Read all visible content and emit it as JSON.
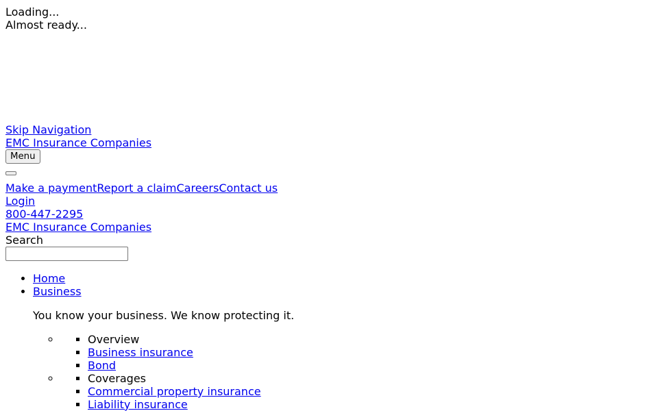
{
  "loading": {
    "line1": "Loading...",
    "line2": "Almost ready..."
  },
  "header": {
    "skip_nav": "Skip Navigation",
    "logo_alt": "EMC Insurance Companies",
    "menu_button": "Menu",
    "utility_links": [
      "Make a payment",
      "Report a claim",
      "Careers",
      "Contact us"
    ],
    "login": "Login",
    "phone": "800-447-2295",
    "logo_alt_2": "EMC Insurance Companies",
    "search_label": "Search",
    "search_value": ""
  },
  "nav": {
    "home": "Home",
    "business": "Business",
    "business_tagline": "You know your business. We know protecting it.",
    "groups": [
      {
        "heading": "Overview",
        "links": [
          "Business insurance",
          "Bond"
        ]
      },
      {
        "heading": "Coverages",
        "links": [
          "Commercial property insurance",
          "Liability insurance"
        ]
      }
    ]
  }
}
